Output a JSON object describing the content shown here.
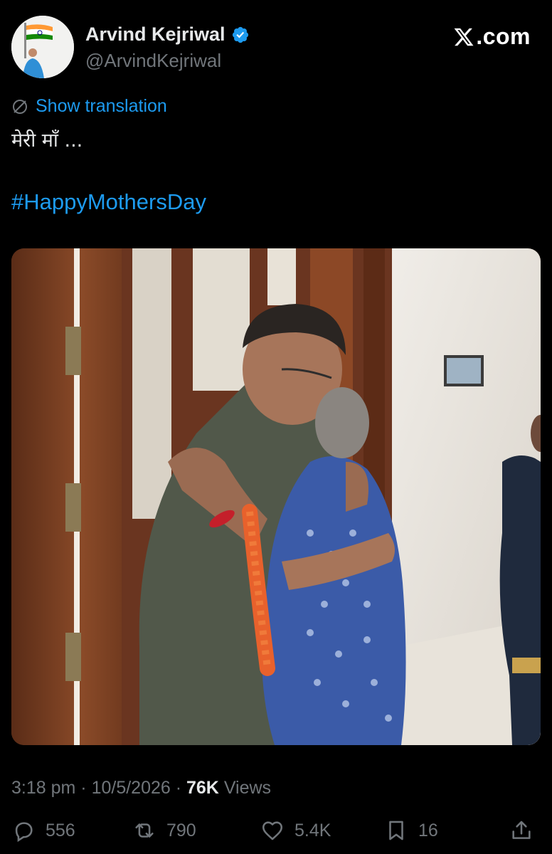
{
  "author": {
    "name": "Arvind Kejriwal",
    "handle": "@ArvindKejriwal",
    "verified": true
  },
  "brand": {
    "label": ".com",
    "icon": "x-logo-icon"
  },
  "translation": {
    "label": "Show translation",
    "icon": "globe-icon"
  },
  "tweet": {
    "text": "मेरी माँ ...",
    "hashtag": "#HappyMothersDay"
  },
  "media": {
    "type": "photo"
  },
  "meta": {
    "time": "3:18 pm",
    "separator": " · ",
    "date": "10/5/2026",
    "views_count": "76K",
    "views_label": " Views"
  },
  "actions": {
    "replies": "556",
    "reposts": "790",
    "likes": "5.4K",
    "bookmarks": "16"
  },
  "colors": {
    "background": "#000000",
    "text_primary": "#e7e9ea",
    "text_secondary": "#71767b",
    "accent": "#1d9bf0"
  }
}
